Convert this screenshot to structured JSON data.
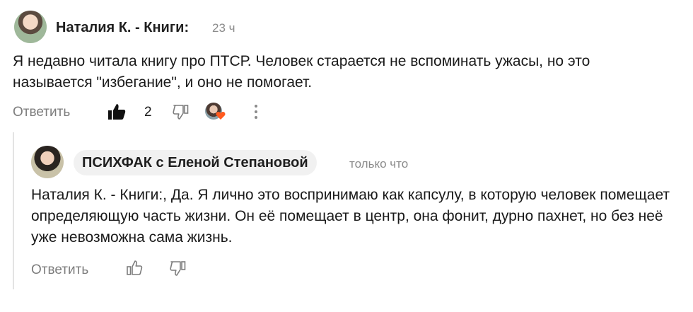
{
  "comment1": {
    "author": "Наталия К. - Книги:",
    "time": "23 ч",
    "text": "Я недавно читала книгу про ПТСР. Человек старается не вспоминать ужасы, но это называется \"избегание\", и оно не помогает.",
    "reply_label": "Ответить",
    "like_count": "2"
  },
  "comment2": {
    "author": "ПСИХФАК с Еленой Степановой",
    "time": "только что",
    "text": "Наталия К. - Книги:, Да. Я лично это воспринимаю как капсулу, в которую человек помещает определяющую часть жизни. Он её помещает в центр, она фонит, дурно пахнет, но без неё уже невозможна сама жизнь.",
    "reply_label": "Ответить"
  },
  "colors": {
    "liked": "#111111",
    "muted": "#7d7d7d",
    "reaction_heart": "#ff5a1f"
  }
}
